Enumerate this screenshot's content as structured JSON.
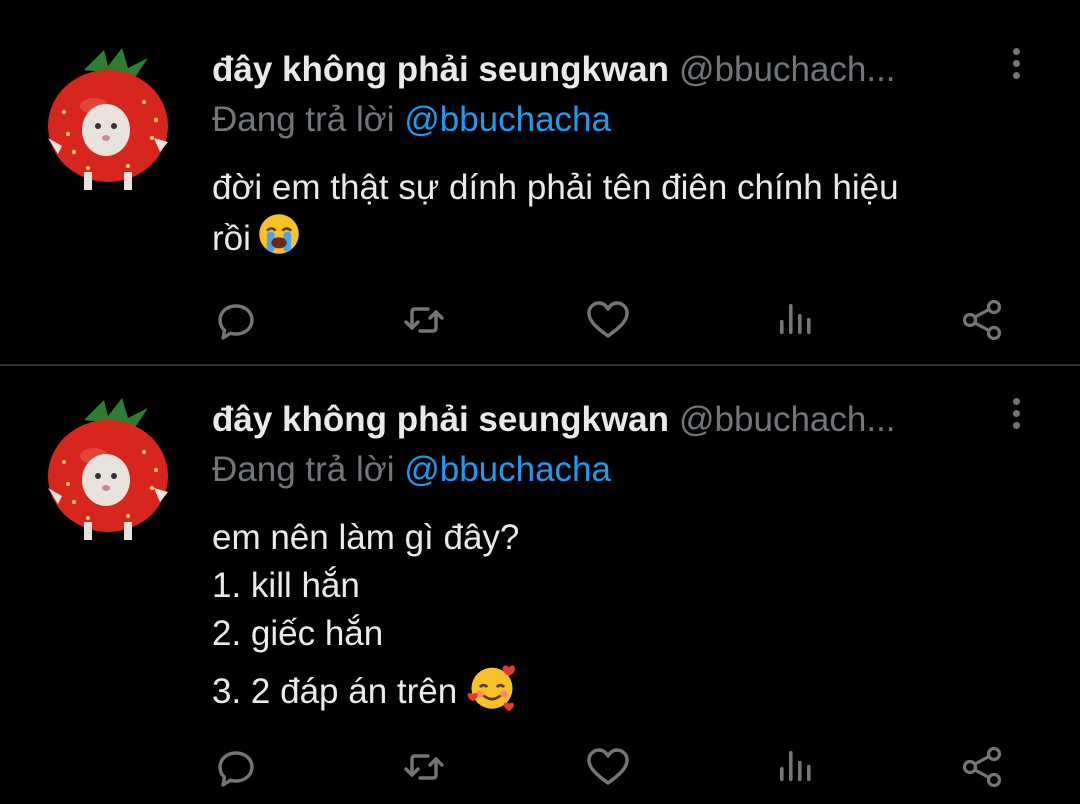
{
  "tweets": [
    {
      "author_name": "đây không phải seungkwan",
      "handle": "@bbuchach...",
      "reply_label": "Đang trả lời",
      "reply_to": "@bbuchacha",
      "text_lines": [
        "đời em thật sự dính phải tên điên chính hiệu",
        "rồi"
      ],
      "trailing_emoji": "loudly-crying-face"
    },
    {
      "author_name": "đây không phải seungkwan",
      "handle": "@bbuchach...",
      "reply_label": "Đang trả lời",
      "reply_to": "@bbuchacha",
      "text_lines": [
        "em nên làm gì đây?",
        "1. kill hắn",
        "2. giếc hắn",
        "3. 2 đáp án trên"
      ],
      "trailing_emoji": "smiling-face-with-hearts"
    }
  ],
  "actions": [
    "reply-icon",
    "retweet-icon",
    "like-icon",
    "views-icon",
    "share-icon"
  ],
  "colors": {
    "background": "#000000",
    "text": "#e7e9ea",
    "muted": "#71767b",
    "link": "#1d9bf0",
    "divider": "#2f3336"
  }
}
